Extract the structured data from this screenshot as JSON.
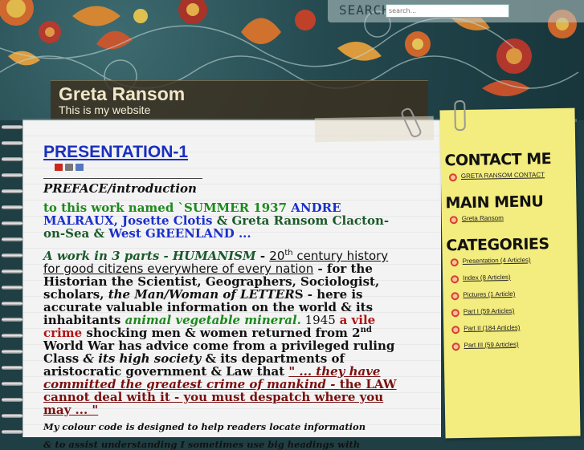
{
  "search": {
    "label": "SEARCH",
    "placeholder": "search..."
  },
  "site": {
    "name": "Greta Ransom",
    "slogan": "This is my website"
  },
  "article": {
    "title": "PRESENTATION-1",
    "icons": [
      "pdf-icon",
      "print-icon",
      "email-icon"
    ],
    "preface": "PREFACE/introduction",
    "p1": {
      "a": "to this work named `SUMMER 1937 ",
      "b": "ANDRE MALRAUX, Josette Clotis",
      "c": " & Greta Ransom Clacton-on-Sea & ",
      "d": "West GREENLAND ..."
    },
    "p2": {
      "a": "A work in 3 parts - HUMANISM",
      "b": " - ",
      "c1": "20",
      "c_sup": "th",
      "c2": " century history for good citizens everywhere of every nation",
      "d": " - for the Historian the Scientist, Geographers, Sociologist, scholars, ",
      "e": "the Man/Woman of LETTER",
      "f": "S - here is accurate valuable information on the world & its inhabitants ",
      "g": "animal vegetable mineral.",
      "h": " 1945 ",
      "i": "a vile crime",
      "j": " shocking men & women returned from 2",
      "j_sup": "nd",
      "k": " World War has advice come from a privileged ruling Class ",
      "l": "& its high society",
      "m": " & its departments of aristocratic government & Law that ",
      "n": "\" ... they have committed the greatest crime of mankind - ",
      "o": "the LAW cannot deal with it - you must despatch where you may ... \""
    },
    "p3": "My colour code is designed to help readers locate information",
    "p4": "& to assist understanding I sometimes use big headings with"
  },
  "sidebar": {
    "contact_title": "CONTACT ME",
    "contact_items": [
      {
        "label": "GRETA RANSOM CONTACT"
      }
    ],
    "menu_title": "MAIN MENU",
    "menu_items": [
      {
        "label": "Greta Ransom"
      }
    ],
    "categories_title": "CATEGORIES",
    "categories": [
      {
        "label": "Presentation (4 Articles)"
      },
      {
        "label": "Index (8 Articles)"
      },
      {
        "label": "Pictures (1 Article)"
      },
      {
        "label": "Part I (59 Articles)"
      },
      {
        "label": "Part II (184 Articles)"
      },
      {
        "label": "Part III (59 Articles)"
      }
    ]
  },
  "colors": {
    "link_blue": "#1a2fbd",
    "green": "#1c8a1c",
    "red": "#b01414",
    "sticky_note": "#f3ec7e",
    "header_teal": "#24494f"
  }
}
